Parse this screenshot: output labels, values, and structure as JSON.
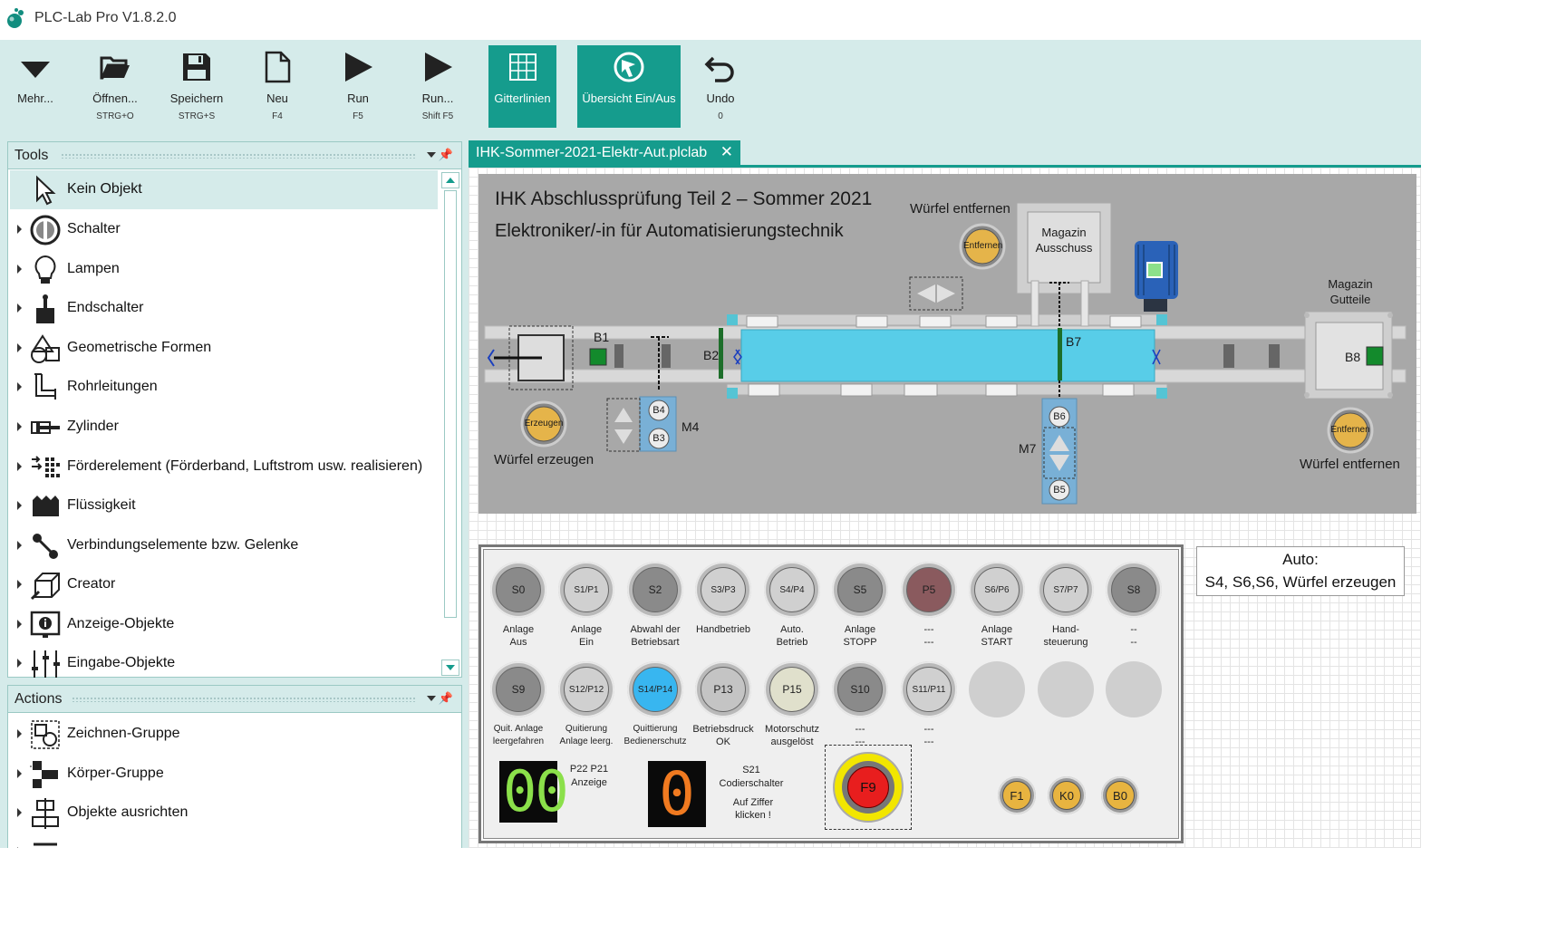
{
  "app": {
    "title": "PLC-Lab Pro V1.8.2.0"
  },
  "ribbon": {
    "buttons": [
      {
        "label": "Mehr...",
        "shortcut": ""
      },
      {
        "label": "Öffnen...",
        "shortcut": "STRG+O"
      },
      {
        "label": "Speichern",
        "shortcut": "STRG+S"
      },
      {
        "label": "Neu",
        "shortcut": "F4"
      },
      {
        "label": "Run",
        "shortcut": "F5"
      },
      {
        "label": "Run...",
        "shortcut": "Shift F5"
      },
      {
        "label": "Gitterlinien",
        "shortcut": ""
      },
      {
        "label": "Übersicht Ein/Aus",
        "shortcut": ""
      },
      {
        "label": "Undo",
        "shortcut": "0"
      }
    ]
  },
  "tools": {
    "title": "Tools",
    "items": [
      {
        "label": "Kein Objekt",
        "icon": "cursor-icon"
      },
      {
        "label": "Schalter",
        "icon": "switch-icon"
      },
      {
        "label": "Lampen",
        "icon": "lamp-icon"
      },
      {
        "label": "Endschalter",
        "icon": "limit-switch-icon"
      },
      {
        "label": "Geometrische Formen",
        "icon": "shapes-icon"
      },
      {
        "label": "Rohrleitungen",
        "icon": "pipe-icon"
      },
      {
        "label": "Zylinder",
        "icon": "cylinder-icon"
      },
      {
        "label": "Förderelement (Förderband, Luftstrom usw. realisieren)",
        "icon": "conveyor-icon"
      },
      {
        "label": "Flüssigkeit",
        "icon": "liquid-icon"
      },
      {
        "label": "Verbindungselemente bzw. Gelenke",
        "icon": "joint-icon"
      },
      {
        "label": "Creator",
        "icon": "creator-icon"
      },
      {
        "label": "Anzeige-Objekte",
        "icon": "display-icon"
      },
      {
        "label": "Eingabe-Objekte",
        "icon": "input-icon"
      }
    ]
  },
  "actions": {
    "title": "Actions",
    "items": [
      {
        "label": "Zeichnen-Gruppe",
        "icon": "draw-group-icon"
      },
      {
        "label": "Körper-Gruppe",
        "icon": "body-group-icon"
      },
      {
        "label": "Objekte ausrichten",
        "icon": "align-icon"
      }
    ]
  },
  "document": {
    "tab_label": "IHK-Sommer-2021-Elektr-Aut.plclab",
    "close": "✕"
  },
  "process": {
    "title1": "IHK Abschlussprüfung Teil 2 – Sommer 2021",
    "title2": "Elektroniker/-in für Automatisierungstechnik",
    "wuerfel_entfernen_top": "Würfel entfernen",
    "entfernen_btn": "Entfernen",
    "magazin_ausschuss": "Magazin\nAusschuss",
    "magazin_gutteile": "Magazin\nGutteile",
    "b1": "B1",
    "b2": "B2",
    "b3": "B3",
    "b4": "B4",
    "b5": "B5",
    "b6": "B6",
    "b7": "B7",
    "b8": "B8",
    "m4": "M4",
    "m7": "M7",
    "erzeugen_btn": "Erzeugen",
    "wuerfel_erzeugen": "Würfel erzeugen",
    "wuerfel_entfernen_right": "Würfel entfernen"
  },
  "control": {
    "row1": [
      {
        "id": "S0",
        "label": "Anlage\nAus",
        "color": "#8a8a8a"
      },
      {
        "id": "S1/P1",
        "label": "Anlage\nEin",
        "color": "#d0d0d0"
      },
      {
        "id": "S2",
        "label": "Abwahl der\nBetriebsart",
        "color": "#8a8a8a"
      },
      {
        "id": "S3/P3",
        "label": "Handbetrieb",
        "color": "#d0d0d0"
      },
      {
        "id": "S4/P4",
        "label": "Auto.\nBetrieb",
        "color": "#d0d0d0"
      },
      {
        "id": "S5",
        "label": "Anlage\nSTOPP",
        "color": "#8a8a8a"
      },
      {
        "id": "P5",
        "label": "---\n---",
        "color": "#8a5a5e"
      },
      {
        "id": "S6/P6",
        "label": "Anlage\nSTART",
        "color": "#d0d0d0"
      },
      {
        "id": "S7/P7",
        "label": "Hand-\nsteuerung",
        "color": "#d0d0d0"
      },
      {
        "id": "S8",
        "label": "--\n--",
        "color": "#8a8a8a"
      }
    ],
    "row2": [
      {
        "id": "S9",
        "label": "Quit. Anlage\nleergefahren",
        "color": "#8a8a8a"
      },
      {
        "id": "S12/P12",
        "label": "Quitierung\nAnlage leerg.",
        "color": "#d0d0d0"
      },
      {
        "id": "S14/P14",
        "label": "Quittierung\nBedienerschutz",
        "color": "#38b6f0"
      },
      {
        "id": "P13",
        "label": "Betriebsdruck\nOK",
        "color": "#c4c4c4"
      },
      {
        "id": "P15",
        "label": "Motorschutz\nausgelöst",
        "color": "#e0e0cc"
      },
      {
        "id": "S10",
        "label": "---\n---",
        "color": "#8a8a8a"
      },
      {
        "id": "S11/P11",
        "label": "---\n---",
        "color": "#d0d0d0"
      }
    ],
    "display1_value": "00",
    "display1_label": "P22 P21\nAnzeige",
    "display2_value": "0",
    "display2_label": "S21\nCodierschalter",
    "display2_hint": "Auf Ziffer\nklicken !",
    "estop_label": "F9",
    "small_buttons": [
      "F1",
      "K0",
      "B0"
    ]
  },
  "autobox": {
    "line1": "Auto:",
    "line2": "S4, S6,S6, Würfel erzeugen"
  }
}
